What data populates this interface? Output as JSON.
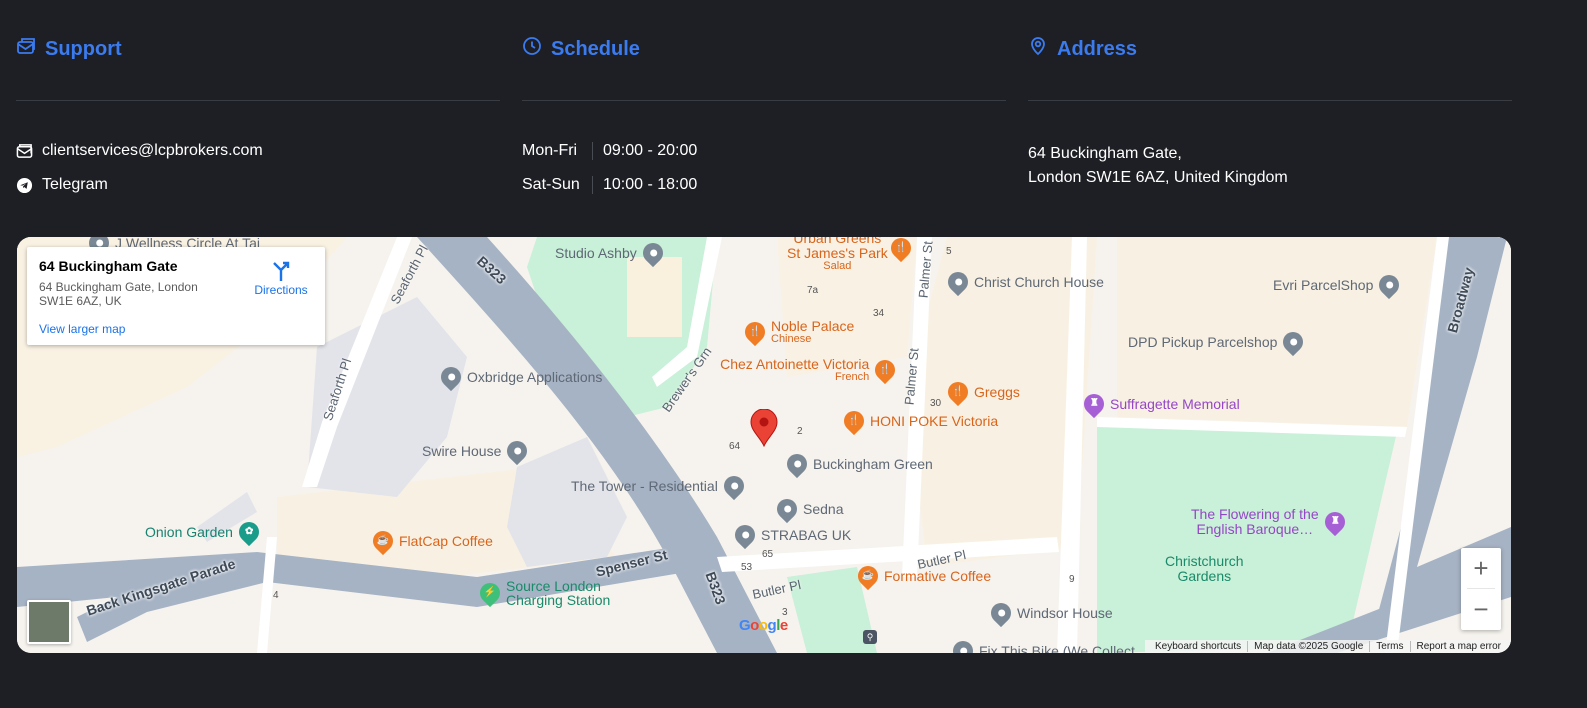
{
  "support": {
    "title": "Support",
    "email": "clientservices@lcpbrokers.com",
    "telegram": "Telegram"
  },
  "schedule": {
    "title": "Schedule",
    "rows": [
      {
        "days": "Mon-Fri",
        "hours": "09:00 - 20:00"
      },
      {
        "days": "Sat-Sun",
        "hours": "10:00 - 18:00"
      }
    ]
  },
  "address": {
    "title": "Address",
    "line1": "64 Buckingham Gate,",
    "line2": "London SW1E 6AZ, United Kingdom"
  },
  "accent_color": "#3b7bf0",
  "map": {
    "info": {
      "name": "64 Buckingham Gate",
      "full": "64 Buckingham Gate, London SW1E 6AZ, UK",
      "larger": "View larger map",
      "directions": "Directions"
    },
    "pois": {
      "wellness": "J Wellness Circle At Tai",
      "studio_ashby": "Studio Ashby",
      "urban_greens": "Urban Greens",
      "st_james_park": "St James's Park",
      "salad": "Salad",
      "christ_church_house": "Christ Church House",
      "evri": "Evri ParcelShop",
      "dpd": "DPD Pickup Parcelshop",
      "noble_palace": "Noble Palace",
      "chinese": "Chinese",
      "oxbridge": "Oxbridge Applications",
      "chez": "Chez Antoinette Victoria",
      "french": "French",
      "greggs": "Greggs",
      "suffragette": "Suffragette Memorial",
      "honi": "HONI POKE Victoria",
      "swire": "Swire House",
      "buckingham_green": "Buckingham Green",
      "tower": "The Tower - Residential",
      "sedna": "Sedna",
      "flowering": "The Flowering of the",
      "flowering2": "English Baroque…",
      "onion": "Onion Garden",
      "strabag": "STRABAG UK",
      "flatcap": "FlatCap Coffee",
      "christchurch": "Christchurch",
      "gardens": "Gardens",
      "source1": "Source London",
      "source2": "Charging Station",
      "formative": "Formative Coffee",
      "windsor": "Windsor House",
      "fixbike": "Fix This Bike (We Collect"
    },
    "roads": {
      "b323a": "B323",
      "b323b": "B323",
      "seaforth1": "Seaforth Pl",
      "seaforth2": "Seaforth Pl",
      "brewers": "Brewer's Grn",
      "palmer1": "Palmer St",
      "palmer2": "Palmer St",
      "broadway": "Broadway",
      "back": "Back Kingsgate Parade",
      "spenser": "Spenser St",
      "butler1": "Butler Pl",
      "butler2": "Butler Pl"
    },
    "numbers": [
      "5",
      "7a",
      "34",
      "30",
      "2",
      "64",
      "65",
      "53",
      "3",
      "4",
      "9"
    ],
    "google": "Google",
    "attribution": [
      "Keyboard shortcuts",
      "Map data ©2025 Google",
      "Terms",
      "Report a map error"
    ]
  }
}
